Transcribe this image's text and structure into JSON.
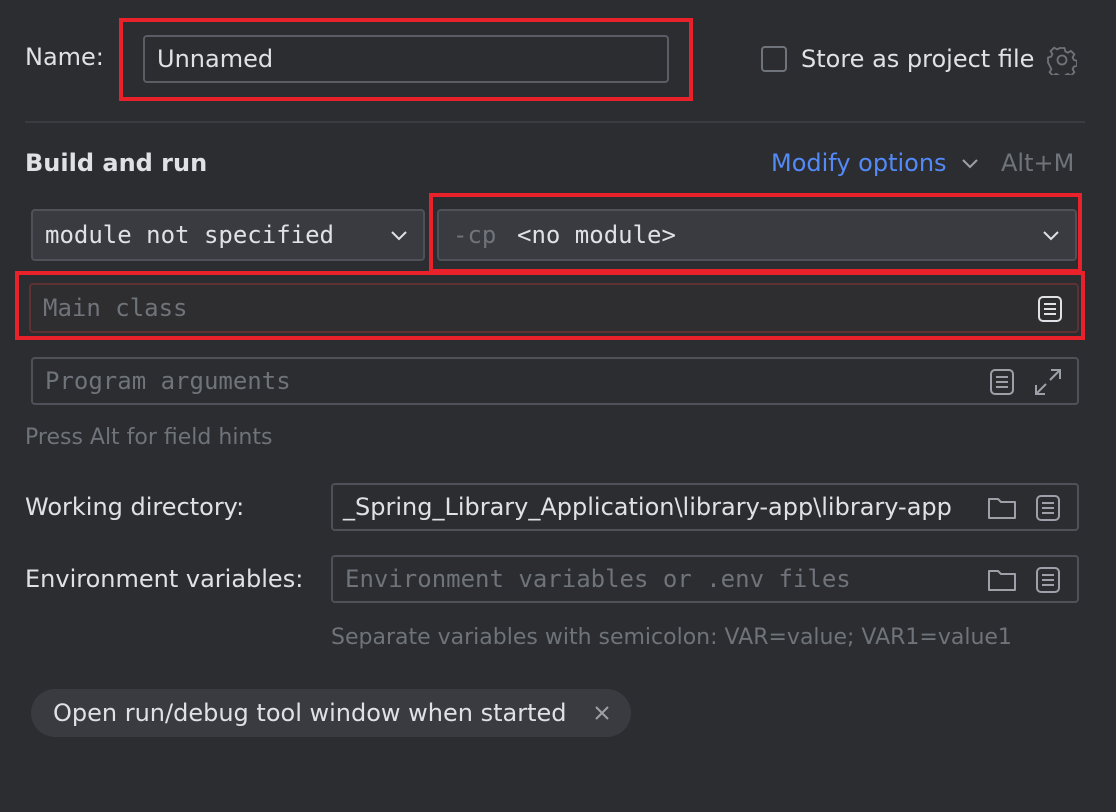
{
  "name": {
    "label": "Name:",
    "value": "Unnamed"
  },
  "store_project": {
    "label": "Store as project file",
    "checked": false
  },
  "build_run": {
    "title": "Build and run",
    "modify_options": "Modify options",
    "shortcut": "Alt+M",
    "module_select": "module not specified",
    "cp_prefix": "-cp",
    "cp_value": "<no module>",
    "main_class_placeholder": "Main class",
    "program_args_placeholder": "Program arguments",
    "hint": "Press Alt for field hints"
  },
  "working_directory": {
    "label": "Working directory:",
    "value": "_Spring_Library_Application\\library-app\\library-app"
  },
  "environment": {
    "label": "Environment variables:",
    "placeholder": "Environment variables or .env files",
    "hint": "Separate variables with semicolon: VAR=value; VAR1=value1"
  },
  "chip": {
    "label": "Open run/debug tool window when started"
  },
  "colors": {
    "background": "#2b2d30",
    "highlight_box": "#e8212b",
    "link": "#548af7",
    "field_border": "#4e5157"
  }
}
